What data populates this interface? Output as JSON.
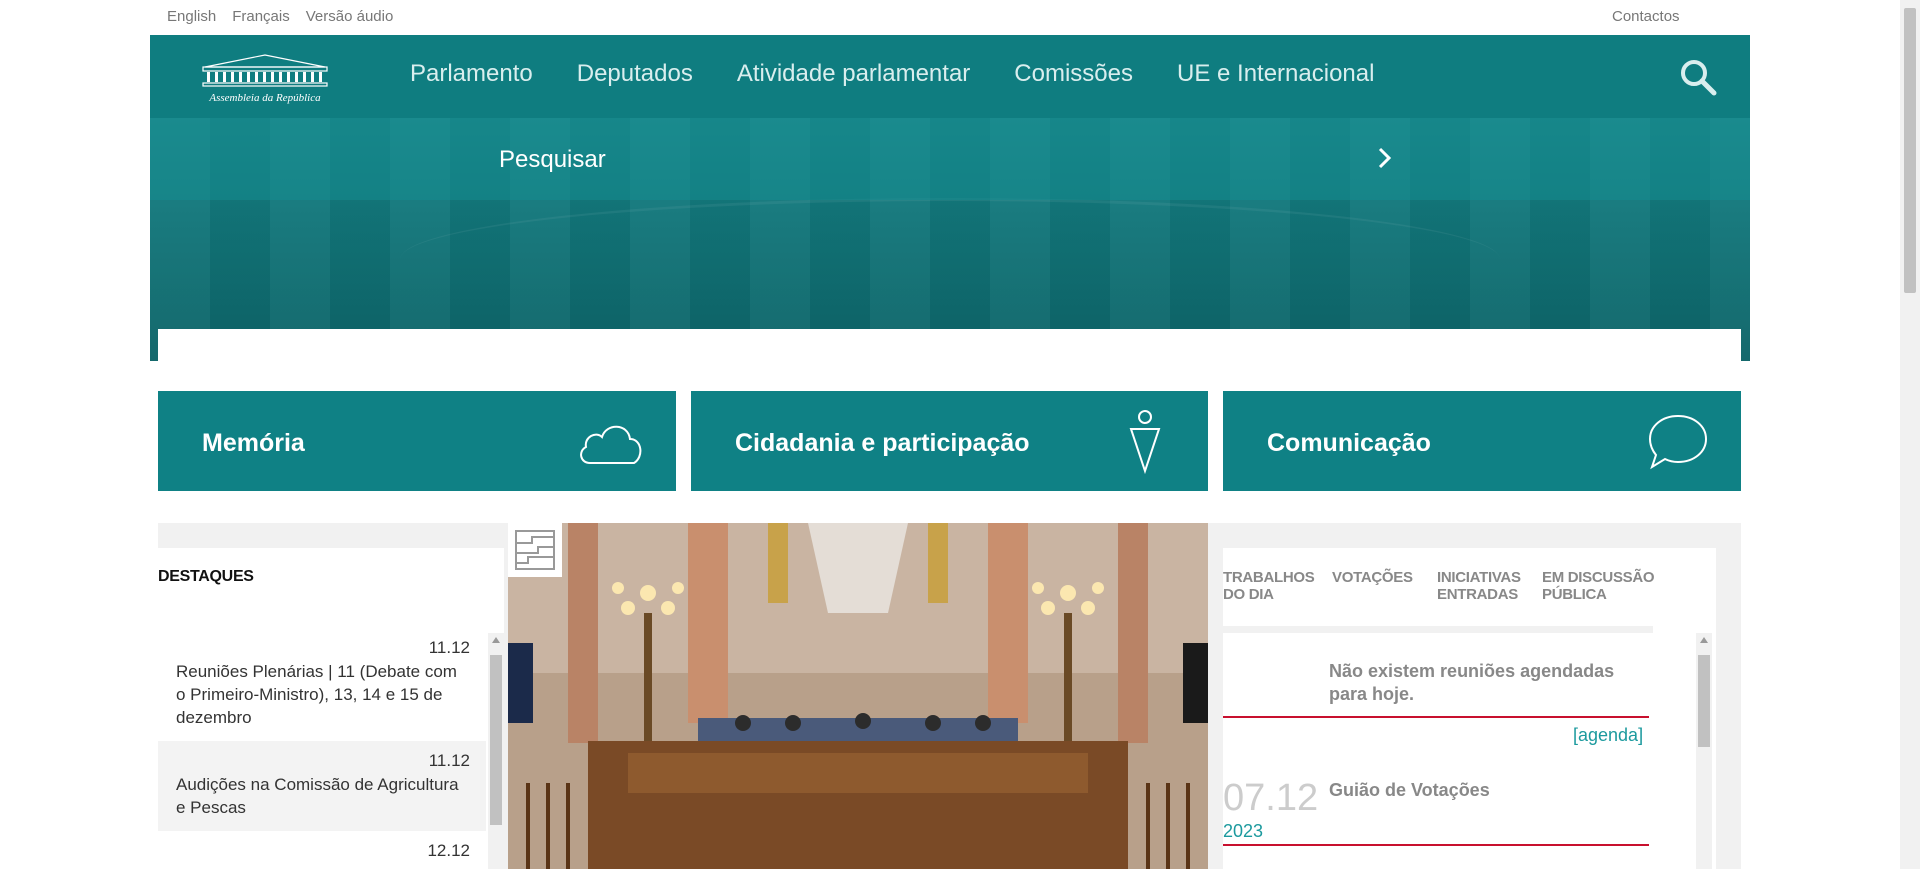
{
  "topbar": {
    "languages": [
      "English",
      "Français",
      "Versão áudio"
    ],
    "contacts": "Contactos"
  },
  "header": {
    "logo_text": "Assembleia da República",
    "nav": [
      "Parlamento",
      "Deputados",
      "Atividade parlamentar",
      "Comissões",
      "UE e Internacional"
    ],
    "search_label": "Pesquisar"
  },
  "tiles": [
    {
      "label": "Memória",
      "icon": "cloud-icon"
    },
    {
      "label": "Cidadania e participação",
      "icon": "person-icon"
    },
    {
      "label": "Comunicação",
      "icon": "speech-bubble-icon"
    }
  ],
  "destaques": {
    "title": "DESTAQUES",
    "items": [
      {
        "date": "11.12",
        "text": "Reuniões Plenárias | 11 (Debate com o Primeiro-Ministro), 13, 14 e 15 de dezembro"
      },
      {
        "date": "11.12",
        "text": "Audições na Comissão de Agricultura e Pescas"
      },
      {
        "date": "12.12",
        "text": ""
      }
    ]
  },
  "agenda": {
    "tabs": [
      {
        "line1": "TRABALHOS",
        "line2": "DO DIA"
      },
      {
        "line1": "VOTAÇÕES",
        "line2": ""
      },
      {
        "line1": "INICIATIVAS",
        "line2": "ENTRADAS"
      },
      {
        "line1": "EM DISCUSSÃO",
        "line2": "PÚBLICA"
      }
    ],
    "no_meetings": "Não existem reuniões agendadas para hoje.",
    "agenda_link": "[agenda]",
    "entry": {
      "day": "07.12",
      "year": "2023",
      "title": "Guião de Votações"
    }
  },
  "colors": {
    "brand": "#0f8185",
    "accent_red": "#c8102e",
    "link": "#1c9a9e"
  }
}
